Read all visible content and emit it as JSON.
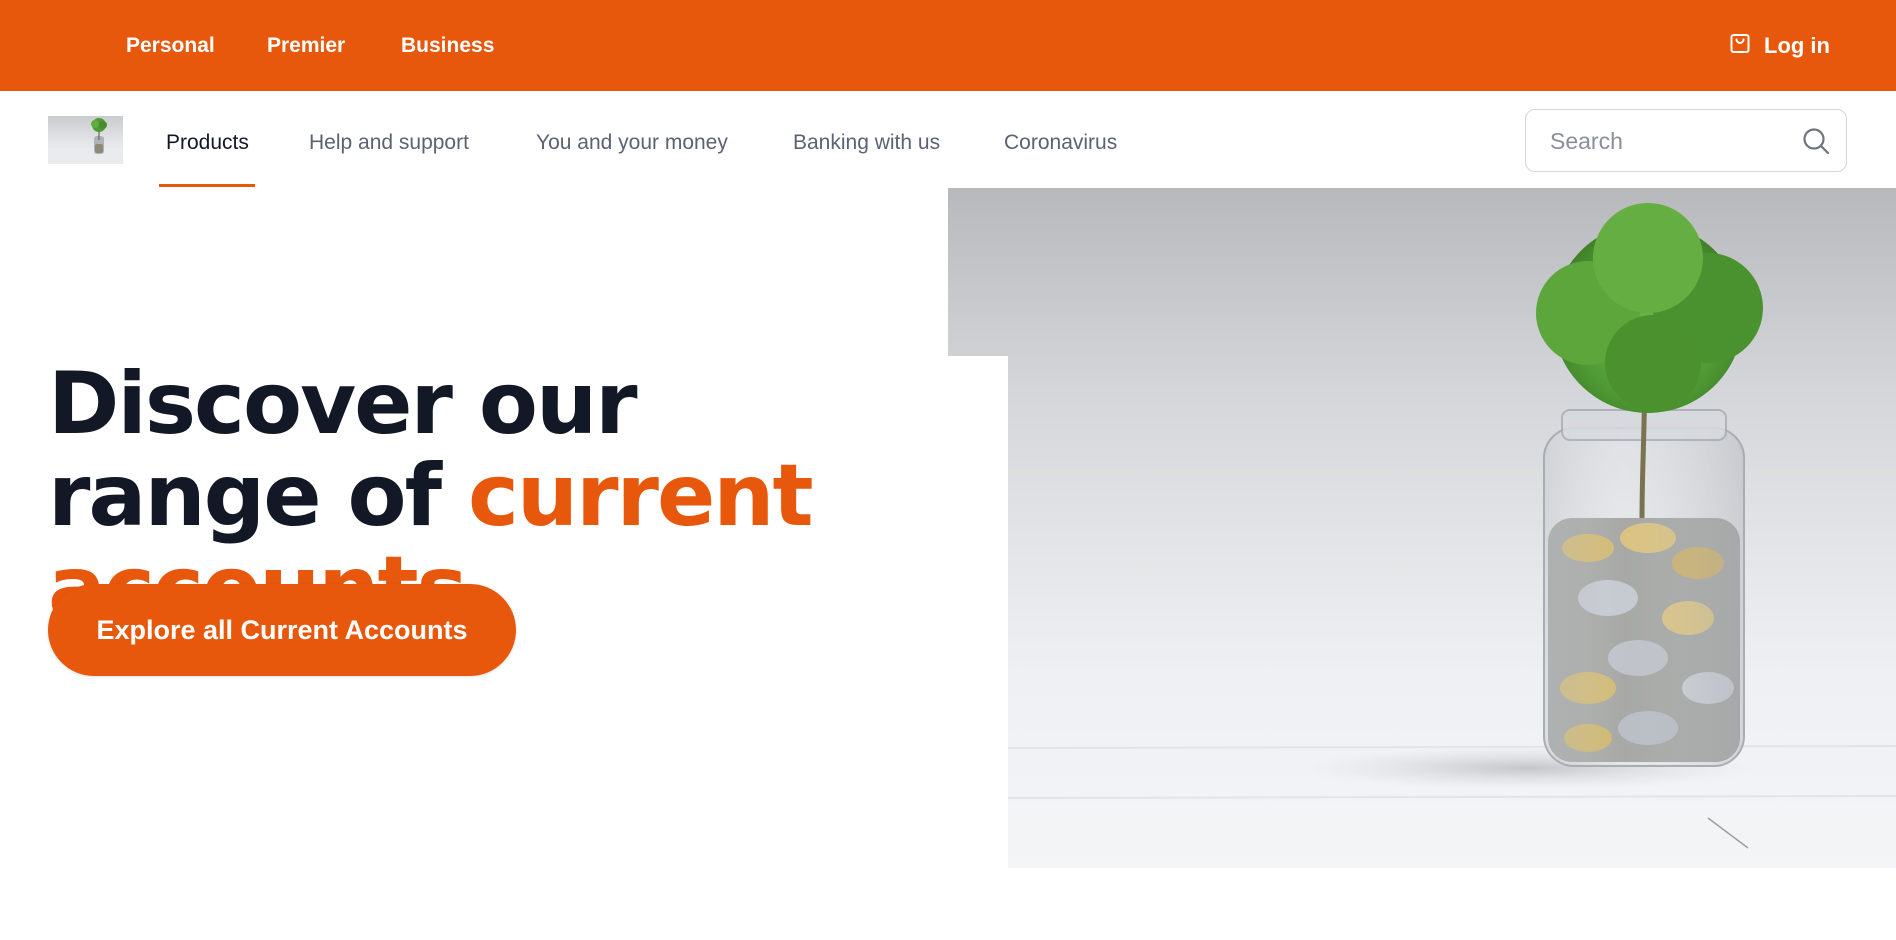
{
  "top_bar": {
    "segments": [
      "Personal",
      "Premier",
      "Business"
    ],
    "login_label": "Log in",
    "login_icon": "shopping-bag-icon"
  },
  "main_nav": {
    "items": [
      "Products",
      "Help and support",
      "You and your money",
      "Banking with us",
      "Coronavirus"
    ],
    "active_item": "Products",
    "search_placeholder": "Search",
    "search_icon": "search-icon"
  },
  "hero": {
    "headline_part1": "Discover our range of ",
    "headline_accent": "current accounts",
    "cta_label": "Explore all Current Accounts",
    "image_subject": "tree-growing-from-coin-jar"
  },
  "colors": {
    "brand_orange": "#e8580c",
    "headline_dark": "#121826",
    "nav_text": "#5b6270"
  }
}
